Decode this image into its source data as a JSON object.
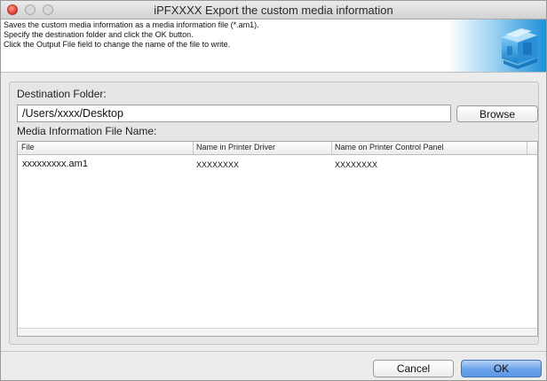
{
  "window": {
    "title": "iPFXXXX Export the custom media information"
  },
  "header": {
    "lines": [
      "Saves the custom media information as a media information file (*.am1).",
      "Specify the destination folder and click the OK button.",
      "Click the Output File field to change the name of the file to write."
    ],
    "logo_icon": "printer-logo-icon"
  },
  "destination": {
    "label": "Destination Folder:",
    "value": "/Users/xxxx/Desktop",
    "browse_label": "Browse"
  },
  "media_file": {
    "label": "Media Information File Name:",
    "columns": [
      "File",
      "Name in Printer Driver",
      "Name on Printer Control Panel"
    ],
    "rows": [
      {
        "file": "xxxxxxxxx.am1",
        "driver": "XXXXXXXX",
        "panel": "XXXXXXXX"
      }
    ]
  },
  "footer": {
    "cancel_label": "Cancel",
    "ok_label": "OK"
  },
  "colors": {
    "ok_button": "#6aa2ea",
    "window_bg": "#ececec",
    "close_button": "#e0443a"
  }
}
